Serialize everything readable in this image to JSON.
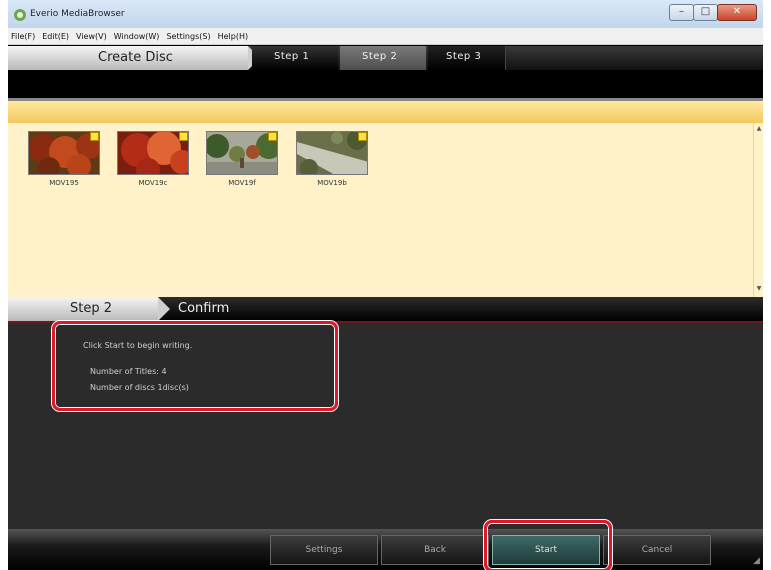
{
  "window": {
    "title": "Everio MediaBrowser",
    "controls": [
      "minimize",
      "maximize",
      "close"
    ]
  },
  "menu": [
    "File(F)",
    "Edit(E)",
    "View(V)",
    "Window(W)",
    "Settings(S)",
    "Help(H)"
  ],
  "steps": {
    "title": "Create Disc",
    "items": [
      "Step 1",
      "Step 2",
      "Step 3"
    ],
    "active": "Step 2"
  },
  "thumbnails": [
    {
      "label": "MOV195",
      "colors": [
        "#8a2a10",
        "#c24a1c",
        "#5e3a15"
      ]
    },
    {
      "label": "MOV19c",
      "colors": [
        "#b32d16",
        "#e06434",
        "#7a1e0f"
      ]
    },
    {
      "label": "MOV19f",
      "colors": [
        "#3d5a2a",
        "#a8a89a",
        "#6f7d45"
      ]
    },
    {
      "label": "MOV19b",
      "colors": [
        "#6a6f4a",
        "#c8c8b8",
        "#4c5a32"
      ]
    }
  ],
  "confirm": {
    "step_label": "Step 2",
    "title": "Confirm",
    "message": "Click Start to begin writing.",
    "titles_count": "Number of Titles: 4",
    "discs_count": "Number of discs 1disc(s)"
  },
  "buttons": {
    "settings": "Settings",
    "back": "Back",
    "start": "Start",
    "cancel": "Cancel"
  },
  "colors": {
    "highlight": "#e0192a",
    "thumb_bg": "#fff2c8",
    "start_button": "#2f5452"
  }
}
